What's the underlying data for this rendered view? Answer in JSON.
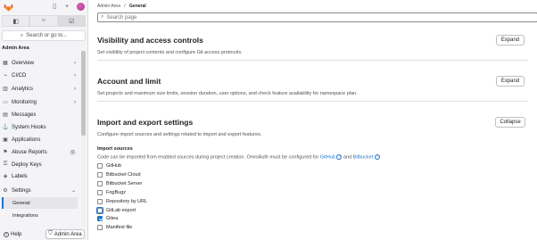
{
  "sidebar": {
    "search_label": "Search or go to...",
    "section_title": "Admin Area",
    "items": [
      {
        "label": "Overview",
        "icon": "overview-icon",
        "glyph": "▦",
        "chevron": "›"
      },
      {
        "label": "CI/CD",
        "icon": "rocket-icon",
        "glyph": "⌁",
        "chevron": "›"
      },
      {
        "label": "Analytics",
        "icon": "chart-icon",
        "glyph": "▥",
        "chevron": "›"
      },
      {
        "label": "Monitoring",
        "icon": "monitor-icon",
        "glyph": "▭",
        "chevron": "›"
      },
      {
        "label": "Messages",
        "icon": "message-icon",
        "glyph": "▤",
        "chevron": ""
      },
      {
        "label": "System Hooks",
        "icon": "hook-icon",
        "glyph": "⚓",
        "chevron": ""
      },
      {
        "label": "Applications",
        "icon": "applications-icon",
        "glyph": "▣",
        "chevron": ""
      },
      {
        "label": "Abuse Reports",
        "icon": "flag-icon",
        "glyph": "⚑",
        "chevron": "",
        "badge": "0"
      },
      {
        "label": "Deploy Keys",
        "icon": "key-icon",
        "glyph": "⚿",
        "chevron": ""
      },
      {
        "label": "Labels",
        "icon": "label-icon",
        "glyph": "◈",
        "chevron": ""
      },
      {
        "label": "Settings",
        "icon": "settings-icon",
        "glyph": "⚙",
        "chevron": "⌄"
      }
    ],
    "subitems": [
      {
        "label": "General",
        "active": true
      },
      {
        "label": "Integrations",
        "active": false
      }
    ],
    "help_label": "Help",
    "admin_area_button": "Admin Area"
  },
  "breadcrumb": {
    "parent": "Admin Area",
    "separator": "/",
    "current": "General"
  },
  "search": {
    "placeholder": "Search page"
  },
  "sections": [
    {
      "title": "Visibility and access controls",
      "description": "Set visibility of project contents and configure Git access protocols.",
      "button": "Expand"
    },
    {
      "title": "Account and limit",
      "description": "Set projects and maximum size limits, session duration, user options, and check feature availability for namespace plan.",
      "button": "Expand"
    },
    {
      "title": "Import and export settings",
      "description": "Configure import sources and settings related to import and export features.",
      "button": "Collapse"
    }
  ],
  "import_sources": {
    "title": "Import sources",
    "help_prefix": "Code can be imported from enabled sources during project creation. OmniAuth must be configured for ",
    "link_github": "GitHub",
    "help_and": " and ",
    "link_bitbucket": "Bitbucket",
    "options": [
      {
        "label": "GitHub",
        "checked": false
      },
      {
        "label": "Bitbucket Cloud",
        "checked": false
      },
      {
        "label": "Bitbucket Server",
        "checked": false
      },
      {
        "label": "FogBugz",
        "checked": false
      },
      {
        "label": "Repository by URL",
        "checked": false
      },
      {
        "label": "GitLab export",
        "checked": false
      },
      {
        "label": "Gitea",
        "checked": true
      },
      {
        "label": "Manifest file",
        "checked": false
      }
    ]
  }
}
